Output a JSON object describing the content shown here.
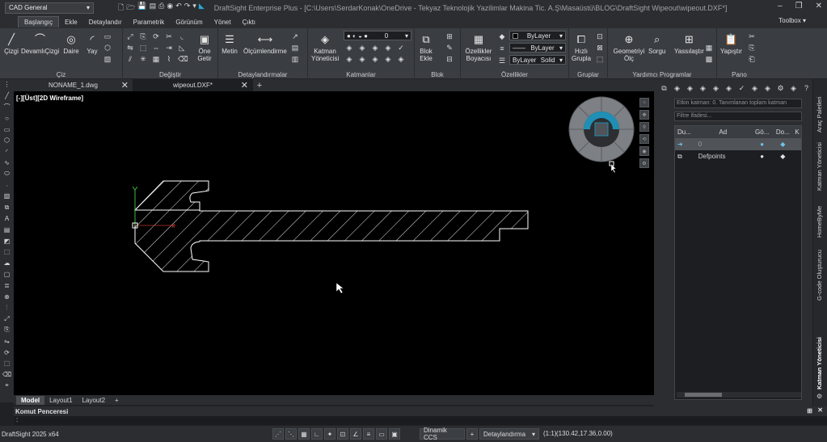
{
  "titlebar": {
    "workspace": "CAD General",
    "title": "DraftSight Enterprise Plus - [C:\\Users\\SerdarKonak\\OneDrive - Tekyaz Teknolojik Yazilimlar Makina Tic. A.Ş\\Masaüstü\\BLOG\\DraftSight Wipeout\\wipeout.DXF*]",
    "toolbox": "Toolbox"
  },
  "ribbon_tabs": [
    "Başlangıç",
    "Ekle",
    "Detaylandır",
    "Parametrik",
    "Görünüm",
    "Yönet",
    "Çıktı"
  ],
  "ribbon": {
    "ciz": {
      "label": "Çiz",
      "cizgi": "Çizgi",
      "devamli": "DevamlıÇizgi",
      "daire": "Daire",
      "yay": "Yay"
    },
    "degistir": {
      "label": "Değiştir",
      "one_getir": "Öne Getir"
    },
    "detay": {
      "label": "Detaylandırmalar",
      "metin": "Metin",
      "olcu": "Ölçümlendirme"
    },
    "katmanlar": {
      "label": "Katmanlar",
      "yonetici": "Katman Yöneticisi",
      "layer_value": "0"
    },
    "blok": {
      "label": "Blok",
      "ekle": "Blok Ekle"
    },
    "ozellikler": {
      "label": "Özellikler",
      "boyaci": "Özellikler Boyacısı",
      "color": "ByLayer",
      "linetype": "ByLayer",
      "lineweight": "ByLayer",
      "style": "Solid"
    },
    "gruplar": {
      "label": "Gruplar",
      "hizli": "Hızlı Grupla"
    },
    "yardimci": {
      "label": "Yardımcı Programlar",
      "geometri": "Geometriyi Ölç",
      "sorgu": "Sorgu",
      "yasslastir": "Yassılaştır"
    },
    "pano": {
      "label": "Pano",
      "yapistir": "Yapıştır"
    }
  },
  "doc_tabs": [
    "NONAME_1.dwg",
    "wipeout.DXF*"
  ],
  "viewport_label": "[-][Üst][2D Wireframe]",
  "layout_tabs": [
    "Model",
    "Layout1",
    "Layout2"
  ],
  "command": {
    "header": "Komut Penceresi",
    "prompt": ":"
  },
  "status": {
    "app": "DraftSight 2025 x64",
    "ccs": "Dinamik CCS",
    "annotation": "Detaylandırma",
    "scale": "(1:1)",
    "coords": "(130.42,17.36,0.00)"
  },
  "layer_manager": {
    "status_text": "Etkin katman: 0. Tanımlanan toplam katman",
    "filter_placeholder": "Filtre ifadesi...",
    "columns": [
      "Du...",
      "Ad",
      "Gö...",
      "Do...",
      "K"
    ],
    "rows": [
      {
        "name": "0",
        "current": true
      },
      {
        "name": "Defpoints",
        "current": false
      }
    ]
  },
  "palette_tabs": [
    "Araç Paletleri",
    "Katman Yöneticisi",
    "HomeByMe",
    "G-code Oluşturucu",
    "Katman Yöneticisi"
  ],
  "colors": {
    "canvas": "#000000",
    "accent": "#1f8fb5",
    "hatch": "#ffffff"
  }
}
